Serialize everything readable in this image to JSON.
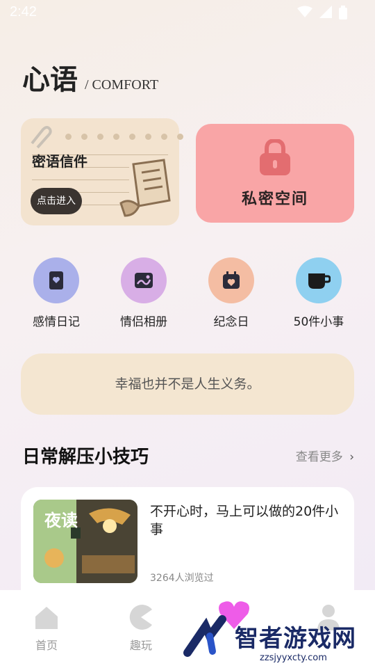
{
  "status": {
    "time": "2:42"
  },
  "header": {
    "title": "心语",
    "subtitle": "/ COMFORT"
  },
  "letter_card": {
    "label": "密语信件",
    "button": "点击进入"
  },
  "private_card": {
    "label": "私密空间"
  },
  "quick": [
    {
      "label": "感情日记",
      "icon": "diary-icon",
      "color": "#aab0ea"
    },
    {
      "label": "情侣相册",
      "icon": "album-icon",
      "color": "#d8aee6"
    },
    {
      "label": "纪念日",
      "icon": "calendar-heart-icon",
      "color": "#f4bda3"
    },
    {
      "label": "50件小事",
      "icon": "cup-icon",
      "color": "#8fd0f0"
    }
  ],
  "quote": "幸福也并不是人生义务。",
  "section": {
    "title": "日常解压小技巧",
    "more": "查看更多"
  },
  "article": {
    "title": "不开心时，马上可以做的20件小事",
    "views": "3264人浏览过",
    "thumb_text": "夜读"
  },
  "tabs": [
    {
      "label": "首页"
    },
    {
      "label": "趣玩"
    }
  ],
  "watermark": {
    "text": "智者游戏网",
    "url": "zzsjyyxcty.com"
  }
}
